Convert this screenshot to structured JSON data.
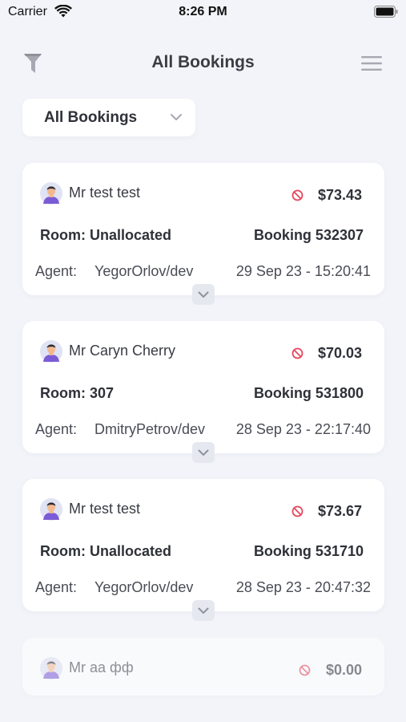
{
  "status_bar": {
    "carrier": "Carrier",
    "time": "8:26 PM"
  },
  "header": {
    "title": "All Bookings"
  },
  "filter": {
    "selected": "All Bookings"
  },
  "bookings": [
    {
      "guest": "Mr test test",
      "amount": "$73.43",
      "room": "Room: Unallocated",
      "booking": "Booking 532307",
      "agent_label": "Agent:",
      "agent": "YegorOrlov/dev",
      "datetime": "29 Sep 23 - 15:20:41"
    },
    {
      "guest": "Mr Caryn Cherry",
      "amount": "$70.03",
      "room": "Room: 307",
      "booking": "Booking 531800",
      "agent_label": "Agent:",
      "agent": "DmitryPetrov/dev",
      "datetime": "28 Sep 23 - 22:17:40"
    },
    {
      "guest": "Mr test test",
      "amount": "$73.67",
      "room": "Room: Unallocated",
      "booking": "Booking 531710",
      "agent_label": "Agent:",
      "agent": "YegorOrlov/dev",
      "datetime": "28 Sep 23 - 20:47:32"
    },
    {
      "guest": "Mr aa фф",
      "amount": "$0.00"
    }
  ],
  "icons": {
    "filter": "filter-icon",
    "menu": "menu-icon",
    "cancel": "cancel-icon",
    "avatar": "avatar",
    "chevron": "chevron-down-icon",
    "wifi": "wifi-icon",
    "battery": "battery-icon"
  },
  "colors": {
    "background": "#f3f4f9",
    "card": "#ffffff",
    "cancel_accent": "#e5485f",
    "text": "#2f3138"
  }
}
